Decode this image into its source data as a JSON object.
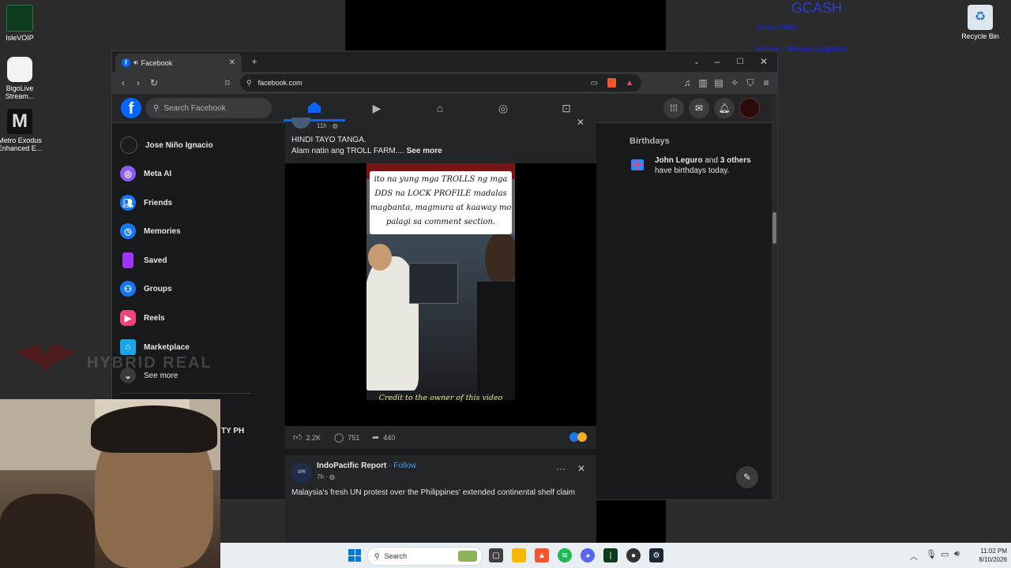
{
  "desktop": {
    "icons": [
      {
        "label": "IsleVOIP"
      },
      {
        "label": "BigoLive Stream..."
      },
      {
        "label": "Metro Exodus Enhanced E..."
      },
      {
        "label": "Recycle Bin"
      }
    ],
    "overlay_title": "GCASH",
    "overlay_lines": [
      "Drina 2500",
      "Keyan - Mouse Logitech"
    ],
    "watermark": "HYBRID REAL"
  },
  "browser": {
    "tab_title": "Facebook",
    "url": "facebook.com"
  },
  "facebook": {
    "search_placeholder": "Search Facebook",
    "sidebar": {
      "profile_name": "Jose Niño Ignacio",
      "items": [
        {
          "label": "Meta AI",
          "icon": "meta-ai-icon",
          "color": "#8b5cf6"
        },
        {
          "label": "Friends",
          "icon": "friends-icon",
          "color": "#1877f2"
        },
        {
          "label": "Memories",
          "icon": "memories-icon",
          "color": "#1877f2"
        },
        {
          "label": "Saved",
          "icon": "saved-icon",
          "color": "#a033ff"
        },
        {
          "label": "Groups",
          "icon": "groups-icon",
          "color": "#1877f2"
        },
        {
          "label": "Reels",
          "icon": "reels-icon",
          "color": "#f0447b"
        },
        {
          "label": "Marketplace",
          "icon": "marketplace-icon",
          "color": "#19a6e8"
        }
      ],
      "see_more": "See more",
      "shortcut_fragment": "TY PH"
    },
    "post": {
      "time": "11h ·",
      "text_line1": "HINDI TAYO TANGA.",
      "text_line2": "Alam natin ang TROLL FARM....",
      "see_more": "See more",
      "video_caption": "ito na yung mga TROLLS ng mga DDS na LOCK PROFILE madalas magbanta, magmura at kaaway mo palagi sa comment section.",
      "video_credit": "Credit to the owner of this video",
      "likes": "2.2K",
      "comments": "751",
      "shares": "440"
    },
    "post2": {
      "page_name": "IndoPacific Report",
      "follow": "Follow",
      "time": "7h ·",
      "text": "Malaysia's fresh UN protest over the Philippines' extended continental shelf claim",
      "avatar_text": "IPR"
    },
    "birthdays": {
      "title": "Birthdays",
      "name": "John Leguro",
      "and_text": "and",
      "others": "3 others",
      "line2": "have birthdays today."
    }
  },
  "taskbar": {
    "search_placeholder": "Search",
    "time": "11:02 PM",
    "date": "8/10/2026"
  }
}
